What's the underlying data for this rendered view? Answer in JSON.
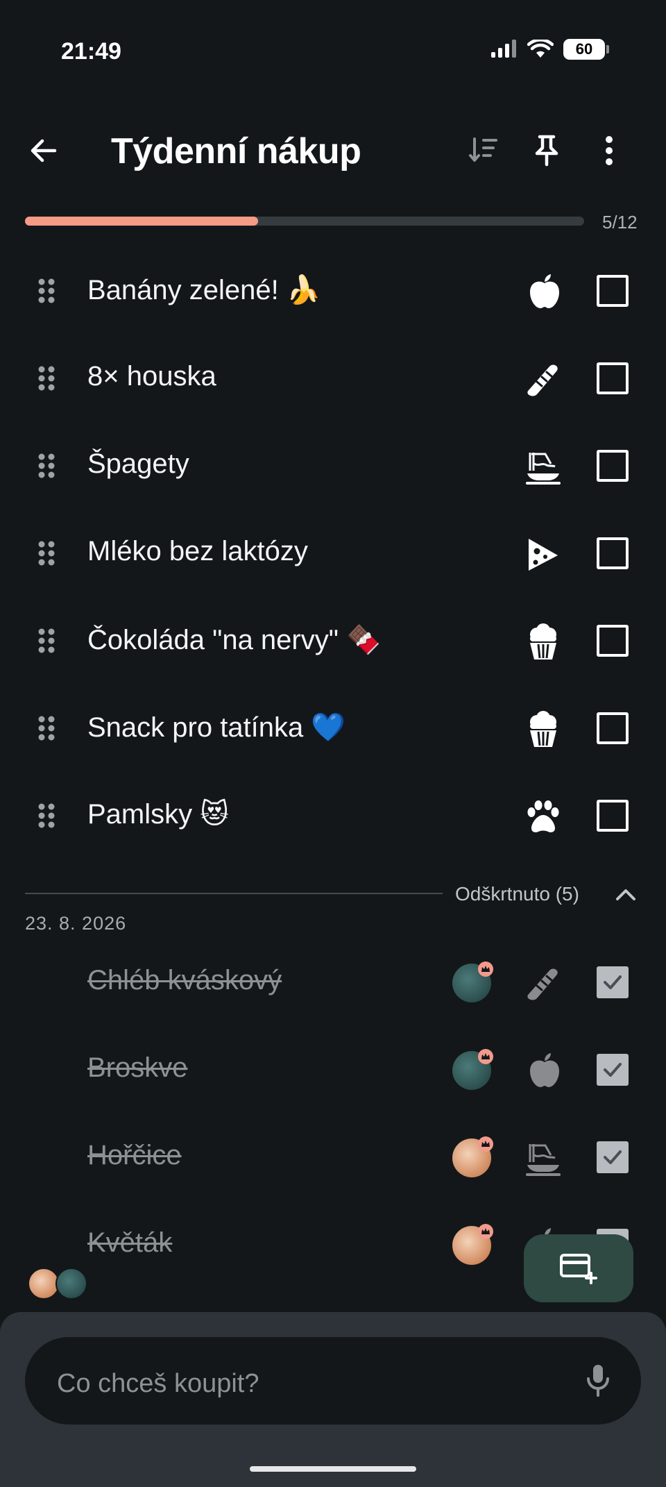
{
  "status": {
    "time": "21:49",
    "battery": "60"
  },
  "header": {
    "title": "Týdenní nákup",
    "back_icon": "arrow-back-icon",
    "sort_icon": "sort-icon",
    "pin_icon": "pin-icon",
    "more_icon": "more-vert-icon"
  },
  "progress": {
    "checked": 5,
    "total": 12,
    "label": "5/12",
    "color": "#f59b86"
  },
  "items": [
    {
      "name": "Banány zelené! 🍌",
      "category_icon": "apple-icon"
    },
    {
      "name": "8× houska",
      "category_icon": "bread-icon"
    },
    {
      "name": "Špagety",
      "category_icon": "pasta-icon"
    },
    {
      "name": "Mléko bez laktózy",
      "category_icon": "cheese-icon"
    },
    {
      "name": "Čokoláda \"na nervy\" 🍫",
      "category_icon": "cupcake-icon"
    },
    {
      "name": "Snack pro tatínka 💙",
      "category_icon": "cupcake-icon"
    },
    {
      "name": "Pamlsky 😻",
      "category_icon": "paw-icon"
    }
  ],
  "checked_section": {
    "label": "Odškrtnuto (5)",
    "date": "23. 8. 2026",
    "items": [
      {
        "name": "Chléb kváskový",
        "category_icon": "bread-icon",
        "user": "male-user-avatar"
      },
      {
        "name": "Broskve",
        "category_icon": "apple-icon",
        "user": "male-user-avatar"
      },
      {
        "name": "Hořčice",
        "category_icon": "pasta-icon",
        "user": "female-user-avatar"
      },
      {
        "name": "Květák",
        "category_icon": "apple-icon",
        "user": "female-user-avatar"
      }
    ]
  },
  "input": {
    "placeholder": "Co chceš koupit?"
  },
  "colors": {
    "background": "#13171a",
    "accent": "#f59b86",
    "fab": "#2e4a42",
    "panel": "#2e3339"
  }
}
